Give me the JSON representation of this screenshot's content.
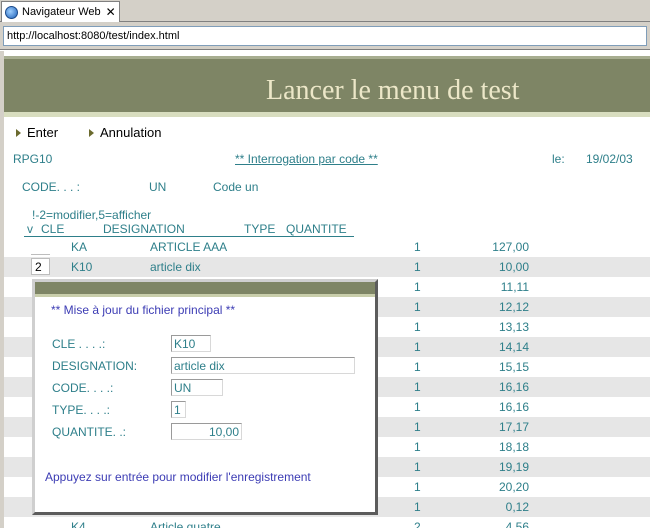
{
  "browser": {
    "tab_title": "Navigateur Web",
    "tab_close": "✕",
    "url": "http://localhost:8080/test/index.html"
  },
  "header": {
    "title": "Lancer le menu de test"
  },
  "function_keys": [
    {
      "label": "Enter"
    },
    {
      "label": "Annulation"
    }
  ],
  "screen": {
    "program": "RPG10",
    "heading": "** Interrogation par code **",
    "date_label": "le:",
    "date_value": "19/02/03",
    "code_label": "CODE. . . :",
    "code_value": "UN",
    "code_desc": "Code un",
    "options_hint": "!-2=modifier,5=afficher",
    "columns": {
      "v": "v",
      "cle": "CLE",
      "designation": "DESIGNATION",
      "type": "TYPE",
      "quantite": "QUANTITE"
    }
  },
  "rows": [
    {
      "opt": "",
      "cle": "KA",
      "designation": "ARTICLE AAA",
      "type": "1",
      "quantite": "127,00"
    },
    {
      "opt": "2",
      "cle": "K10",
      "designation": "article dix",
      "type": "1",
      "quantite": "10,00"
    },
    {
      "opt": "",
      "cle": "",
      "designation": "",
      "type": "1",
      "quantite": "11,11"
    },
    {
      "opt": "",
      "cle": "",
      "designation": "",
      "type": "1",
      "quantite": "12,12"
    },
    {
      "opt": "",
      "cle": "",
      "designation": "",
      "type": "1",
      "quantite": "13,13"
    },
    {
      "opt": "",
      "cle": "",
      "designation": "",
      "type": "1",
      "quantite": "14,14"
    },
    {
      "opt": "",
      "cle": "",
      "designation": "",
      "type": "1",
      "quantite": "15,15"
    },
    {
      "opt": "",
      "cle": "",
      "designation": "",
      "type": "1",
      "quantite": "16,16"
    },
    {
      "opt": "",
      "cle": "",
      "designation": "",
      "type": "1",
      "quantite": "16,16"
    },
    {
      "opt": "",
      "cle": "",
      "designation": "",
      "type": "1",
      "quantite": "17,17"
    },
    {
      "opt": "",
      "cle": "",
      "designation": "",
      "type": "1",
      "quantite": "18,18"
    },
    {
      "opt": "",
      "cle": "",
      "designation": "",
      "type": "1",
      "quantite": "19,19"
    },
    {
      "opt": "",
      "cle": "",
      "designation": "",
      "type": "1",
      "quantite": "20,20"
    },
    {
      "opt": "",
      "cle": "",
      "designation": "",
      "type": "1",
      "quantite": "0,12"
    },
    {
      "opt": "",
      "cle": "K4",
      "designation": "Article quatre",
      "type": "2",
      "quantite": "4,56"
    }
  ],
  "dialog": {
    "title": "** Mise à jour du fichier principal **",
    "cle_label": "CLE . . . .:",
    "cle_value": "K10",
    "designation_label": "DESIGNATION:",
    "designation_value": "article dix",
    "code_label": "CODE. . . .:",
    "code_value": "UN",
    "type_label": "TYPE. . . .:",
    "type_value": "1",
    "quantite_label": "QUANTITE. .:",
    "quantite_value": "10,00",
    "message": "Appuyez sur entrée pour modifier l'enregistrement"
  }
}
